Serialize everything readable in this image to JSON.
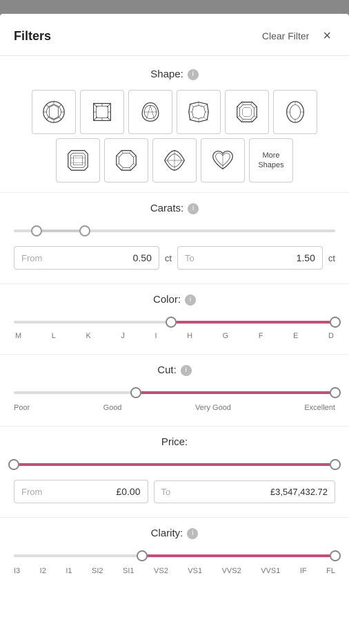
{
  "header": {
    "title": "Filters",
    "clear_filter_label": "Clear Filter",
    "close_label": "×"
  },
  "shape_section": {
    "label": "Shape:",
    "shapes": [
      {
        "id": "round",
        "type": "round"
      },
      {
        "id": "princess",
        "type": "princess"
      },
      {
        "id": "pear",
        "type": "pear"
      },
      {
        "id": "cushion",
        "type": "cushion"
      },
      {
        "id": "asscher",
        "type": "asscher"
      },
      {
        "id": "oval",
        "type": "oval"
      },
      {
        "id": "emerald",
        "type": "emerald"
      },
      {
        "id": "radiant",
        "type": "radiant"
      },
      {
        "id": "marquise",
        "type": "marquise"
      },
      {
        "id": "heart",
        "type": "heart"
      }
    ],
    "more_shapes_label": "More\nShapes"
  },
  "carats_section": {
    "label": "Carats:",
    "from_placeholder": "From",
    "from_value": "0.50",
    "to_placeholder": "To",
    "to_value": "1.50",
    "unit": "ct",
    "thumb_left_pct": 7,
    "thumb_right_pct": 22
  },
  "color_section": {
    "label": "Color:",
    "labels": [
      "M",
      "L",
      "K",
      "J",
      "I",
      "H",
      "G",
      "F",
      "E",
      "D"
    ],
    "thumb_left_pct": 49,
    "thumb_right_pct": 100,
    "fill_start_pct": 49,
    "fill_end_pct": 100
  },
  "cut_section": {
    "label": "Cut:",
    "labels": [
      "Poor",
      "Good",
      "Very Good",
      "Excellent"
    ],
    "thumb_left_pct": 38,
    "thumb_right_pct": 100,
    "fill_start_pct": 38,
    "fill_end_pct": 100
  },
  "price_section": {
    "label": "Price:",
    "from_placeholder": "From",
    "from_value": "£0.00",
    "to_placeholder": "To",
    "to_value": "£3,547,432.72",
    "thumb_left_pct": 0,
    "thumb_right_pct": 100
  },
  "clarity_section": {
    "label": "Clarity:",
    "thumb_left_pct": 40,
    "thumb_right_pct": 100,
    "fill_start_pct": 40,
    "fill_end_pct": 100
  }
}
